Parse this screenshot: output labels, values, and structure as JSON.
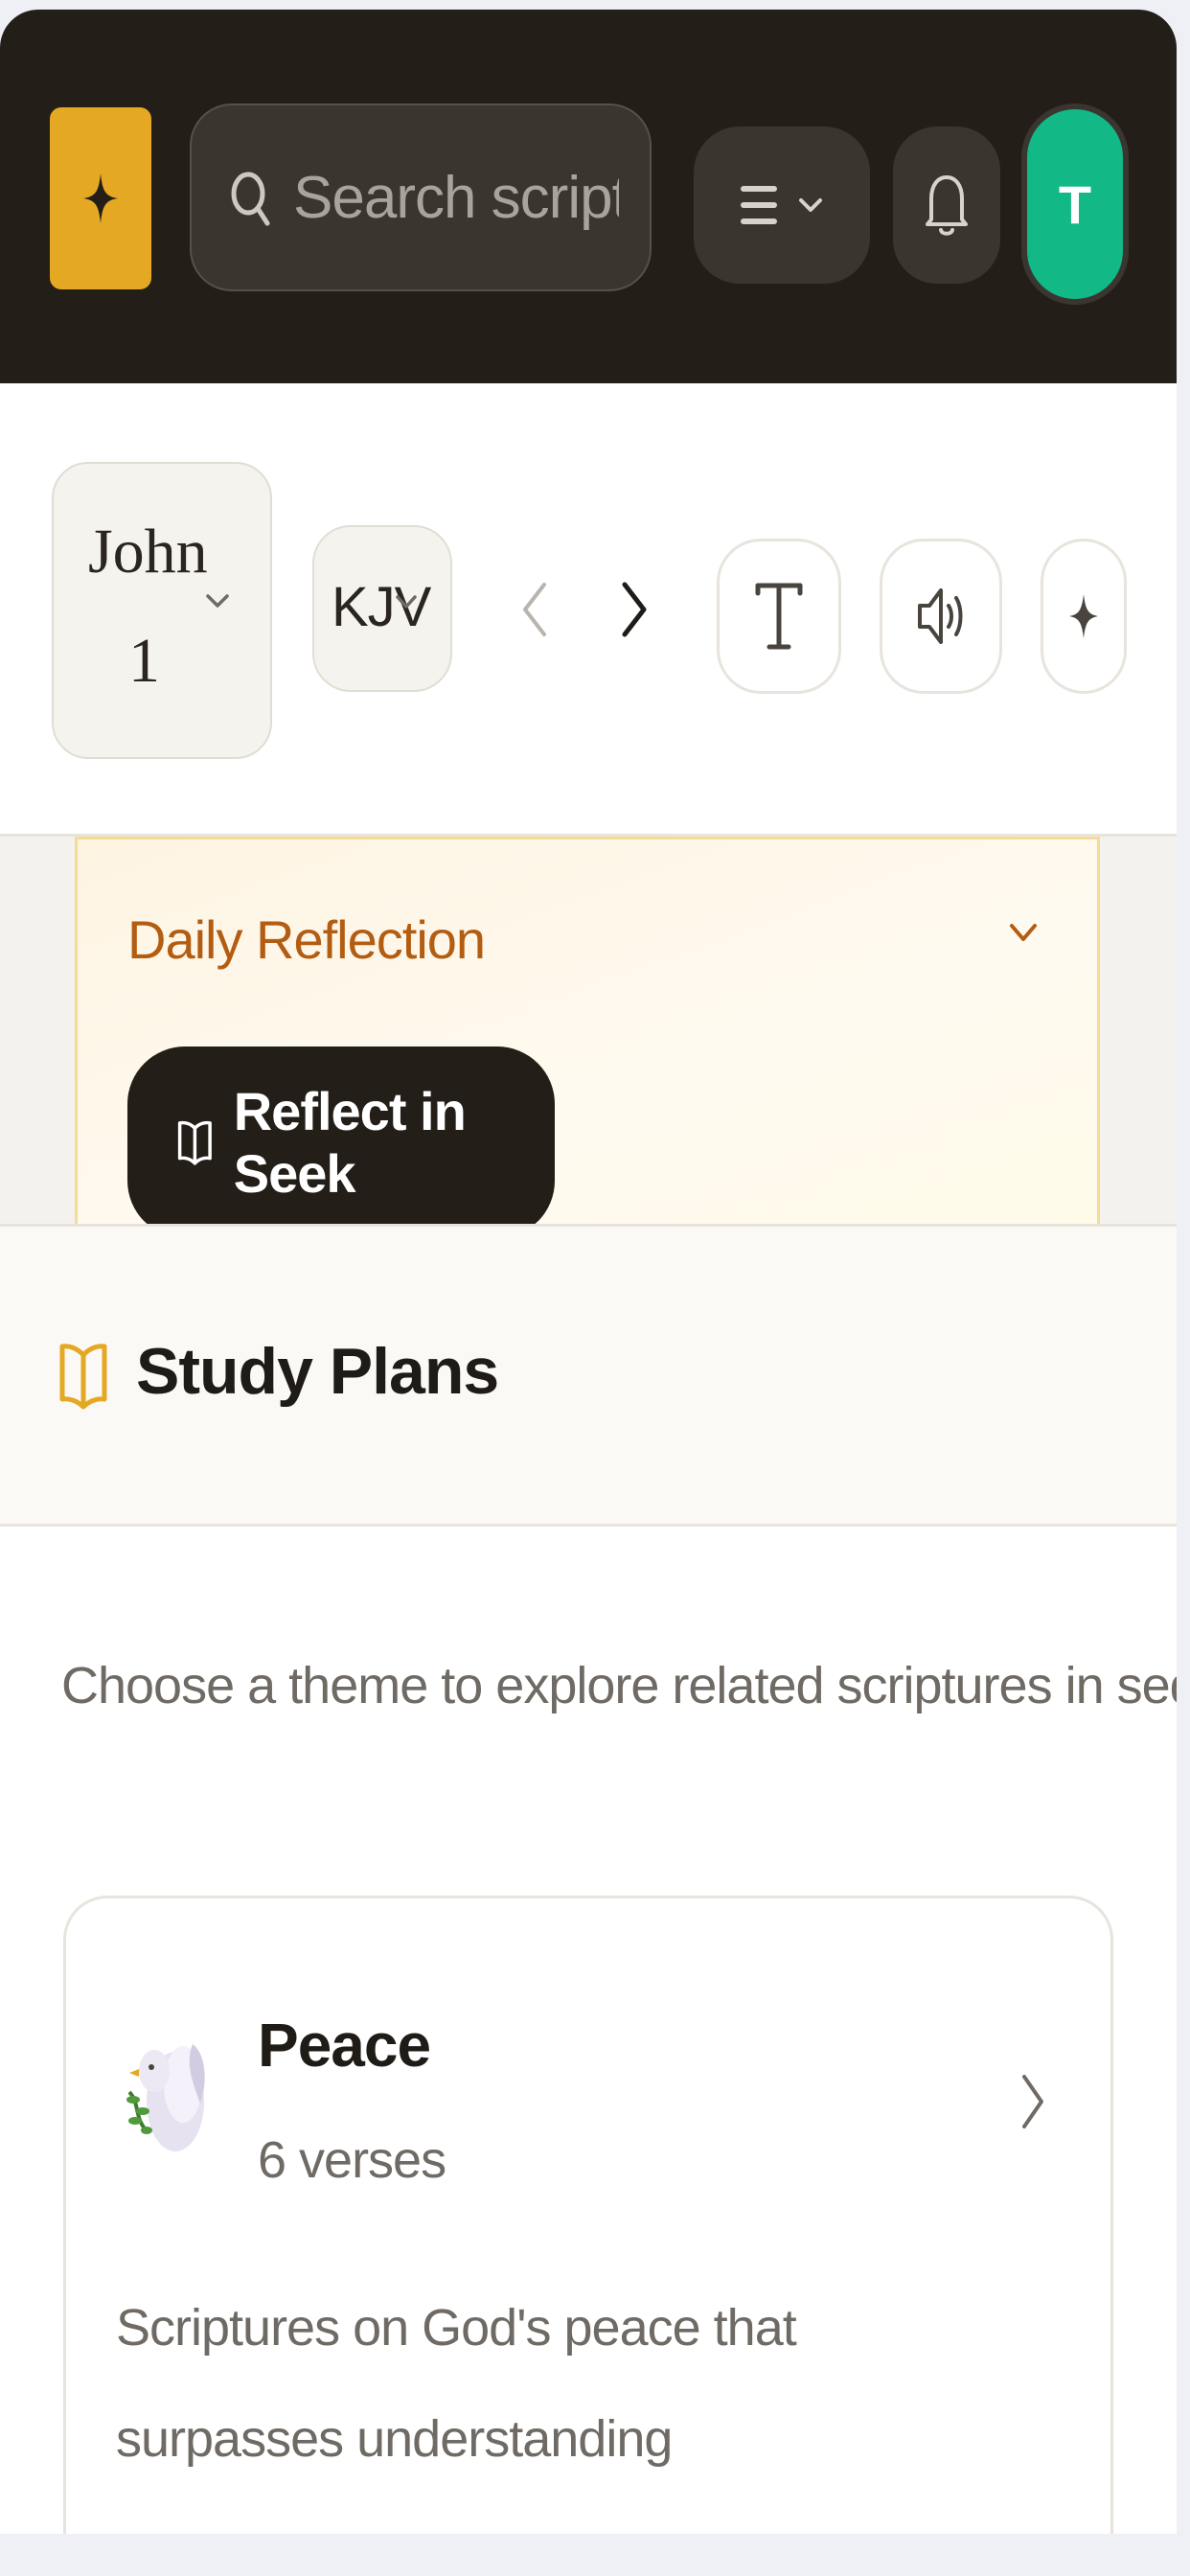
{
  "header": {
    "search": {
      "placeholder": "Search scripture"
    },
    "avatar_initial": "T",
    "icons": [
      "sparkle-icon",
      "search-icon",
      "menu-icon",
      "chevron-down-icon",
      "bell-icon"
    ]
  },
  "reader": {
    "book": "John",
    "chapter": "1",
    "version": "KJV",
    "icons": [
      "chevron-left-icon",
      "chevron-right-icon",
      "text-size-icon",
      "speaker-icon",
      "sparkle-icon"
    ]
  },
  "daily_reflection": {
    "title": "Daily Reflection",
    "button_label": "Reflect in Seek"
  },
  "study_plans": {
    "title": "Study Plans",
    "description": "Choose a theme to explore related scriptures in sequence.",
    "plans": [
      {
        "title": "Peace",
        "count": "6 verses",
        "description": "Scriptures on God's peace that surpasses understanding",
        "icon": "dove-icon"
      }
    ]
  },
  "colors": {
    "header_bg": "#241e19",
    "accent_gold": "#e4a822",
    "avatar_green": "#12b886",
    "reflection_title": "#b35d12",
    "reflection_border": "#f4dc94"
  }
}
